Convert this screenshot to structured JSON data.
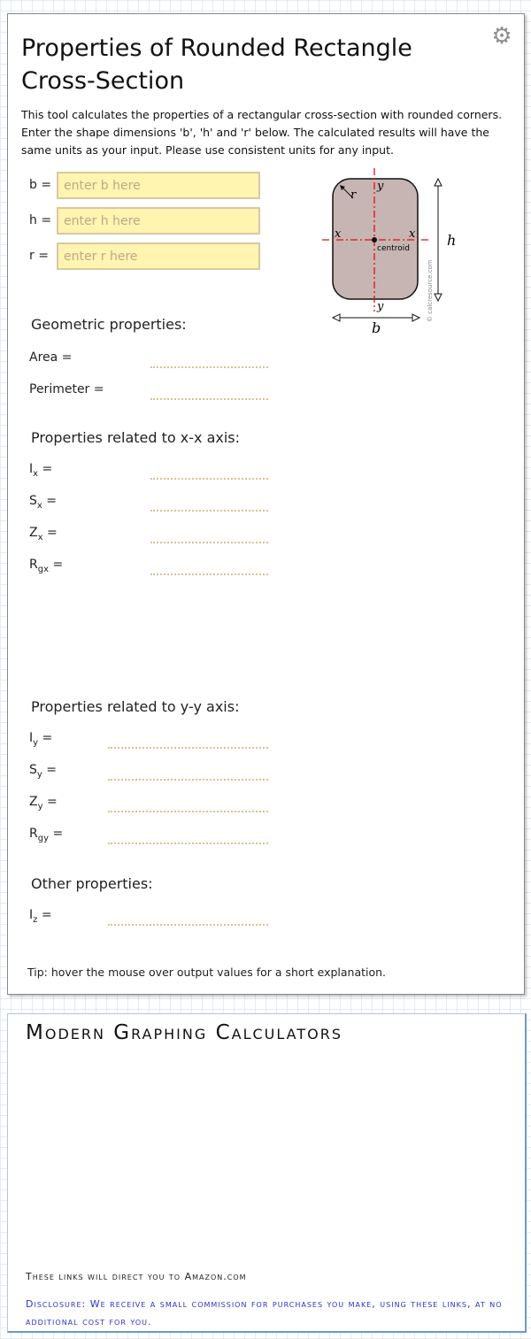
{
  "calculator": {
    "title": "Properties of Rounded Rectangle Cross-Section",
    "settings_icon": "gear-icon",
    "intro": "This tool calculates the properties of a rectangular cross-section with rounded corners. Enter the shape dimensions 'b', 'h' and 'r' below. The calculated results will have the same units as your input. Please use consistent units for any input.",
    "inputs": [
      {
        "label": "b =",
        "placeholder": "enter b here",
        "value": ""
      },
      {
        "label": "h =",
        "placeholder": "enter h here",
        "value": ""
      },
      {
        "label": "r =",
        "placeholder": "enter r here",
        "value": ""
      }
    ],
    "diagram": {
      "y_top": "y",
      "y_bottom": "y",
      "x_left": "x",
      "x_right": "x",
      "r": "r",
      "h": "h",
      "b": "b",
      "centroid": "centroid",
      "copyright": "© calcresource.com",
      "colors": {
        "fill": "#c7b5b3",
        "axis": "#e01010"
      }
    },
    "geometric": {
      "heading": "Geometric properties:",
      "area": {
        "label": "Area =",
        "value": ""
      },
      "perimeter": {
        "label": "Perimeter =",
        "value": ""
      }
    },
    "xx": {
      "heading": "Properties related to x-x axis:",
      "rows": [
        {
          "sym": "I",
          "sub": "x",
          "eq": " =",
          "value": ""
        },
        {
          "sym": "S",
          "sub": "x",
          "eq": " =",
          "value": ""
        },
        {
          "sym": "Z",
          "sub": "x",
          "eq": " =",
          "value": ""
        },
        {
          "sym": "R",
          "sub": "gx",
          "eq": " =",
          "value": ""
        }
      ]
    },
    "yy": {
      "heading": "Properties related to y-y axis:",
      "rows": [
        {
          "sym": "I",
          "sub": "y",
          "eq": " =",
          "value": ""
        },
        {
          "sym": "S",
          "sub": "y",
          "eq": " =",
          "value": ""
        },
        {
          "sym": "Z",
          "sub": "y",
          "eq": " =",
          "value": ""
        },
        {
          "sym": "R",
          "sub": "gy",
          "eq": " =",
          "value": ""
        }
      ]
    },
    "other": {
      "heading": "Other properties:",
      "rows": [
        {
          "sym": "I",
          "sub": "z",
          "eq": " =",
          "value": ""
        }
      ]
    },
    "tip": "Tip: hover the mouse over output values for a short explanation."
  },
  "ad": {
    "heading": "Modern Graphing Calculators",
    "links_note": "These links will direct you to Amazon.com",
    "disclosure": "Disclosure: We receive a small commission for purchases you make, using these links, at no additional cost for you."
  }
}
